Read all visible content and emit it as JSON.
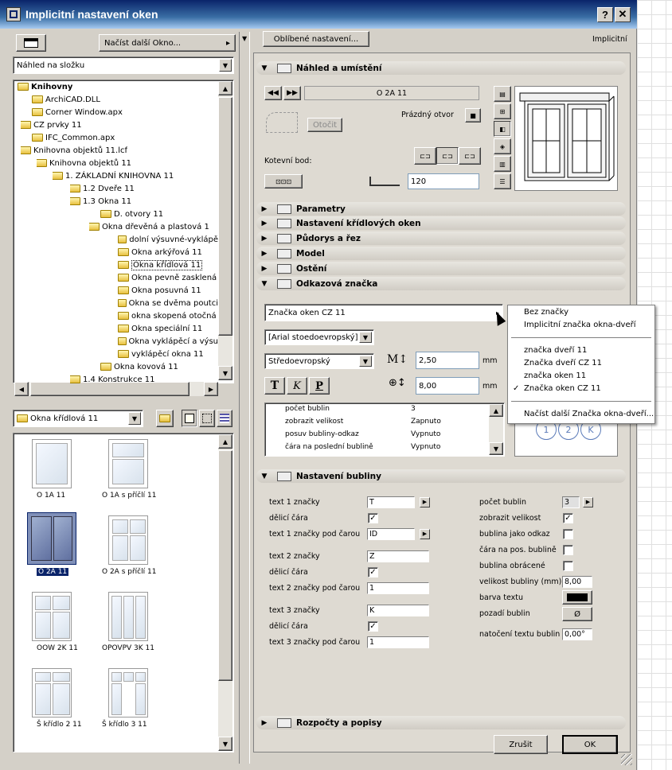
{
  "window": {
    "title": "Implicitní nastavení oken",
    "help": "?",
    "close": "✕"
  },
  "left": {
    "load_button": "Načíst další Okno...",
    "view_select": "Náhled na složku",
    "tree": [
      {
        "label": "Knihovny",
        "bold": true
      },
      {
        "label": "ArchiCAD.DLL"
      },
      {
        "label": "Corner Window.apx"
      },
      {
        "label": "CZ prvky 11"
      },
      {
        "label": "IFC_Common.apx"
      },
      {
        "label": "Knihovna objektů 11.lcf"
      },
      {
        "label": "Knihovna objektů 11"
      },
      {
        "label": "1. ZÁKLADNÍ KNIHOVNA 11"
      },
      {
        "label": "1.2 Dveře 11"
      },
      {
        "label": "1.3 Okna 11"
      },
      {
        "label": "D. otvory 11"
      },
      {
        "label": "Okna dřevěná a plastová 1"
      },
      {
        "label": "dolní výsuvné-vyklápě"
      },
      {
        "label": "Okna arkýřová 11"
      },
      {
        "label": "Okna křídlová 11"
      },
      {
        "label": "Okna pevně zasklená"
      },
      {
        "label": "Okna posuvná 11"
      },
      {
        "label": "Okna se dvěma poutci"
      },
      {
        "label": "okna skopená otočná"
      },
      {
        "label": "Okna speciální 11"
      },
      {
        "label": "Okna vyklápěcí a výsu"
      },
      {
        "label": "vyklápěcí okna 11"
      },
      {
        "label": "Okna kovová 11"
      },
      {
        "label": "1.4 Konstrukce 11"
      }
    ],
    "folder_select": "Okna křídlová 11",
    "thumbs": [
      {
        "label": "O 1A 11"
      },
      {
        "label": "O 1A s příčlí 11"
      },
      {
        "label": "O 2A 11"
      },
      {
        "label": "O 2A s příčlí 11"
      },
      {
        "label": "OOW 2K 11"
      },
      {
        "label": "OPOVPV 3K 11"
      },
      {
        "label": "Š křídlo 2 11"
      },
      {
        "label": "Š křídlo 3 11"
      }
    ]
  },
  "right": {
    "favorites_button": "Oblíbené nastavení...",
    "implicit_label": "Implicitní",
    "preview_section": "Náhled a umístění",
    "object_name": "O 2A 11",
    "empty_opening": "Prázdný otvor",
    "rotate_button": "Otočit",
    "anchor_label": "Kotevní bod:",
    "anchor_value": "120",
    "sections": [
      {
        "label": "Parametry"
      },
      {
        "label": "Nastavení křídlových oken"
      },
      {
        "label": "Půdorys a řez"
      },
      {
        "label": "Model"
      },
      {
        "label": "Ostění"
      },
      {
        "label": "Odkazová značka"
      }
    ],
    "marker_select": "Značka oken CZ 11",
    "font_select": "[Arial stoedoevropský]",
    "encoding_select": "Středoevropský",
    "size1": "2,50",
    "size2": "8,00",
    "unit": "mm",
    "style_buttons": [
      "T",
      "K",
      "P"
    ],
    "param_rows": [
      {
        "name": "počet bublin",
        "value": "3"
      },
      {
        "name": "zobrazit velikost",
        "value": "Zapnuto"
      },
      {
        "name": "posuv bubliny-odkaz",
        "value": "Vypnuto"
      },
      {
        "name": "čára na poslední bublině",
        "value": "Vypnuto"
      }
    ],
    "bubble_letters": [
      "1",
      "2",
      "K"
    ],
    "bubble_section": "Nastavení bubliny",
    "bubble_left": [
      {
        "label": "text 1 značky",
        "value": "T",
        "kind": "input-arrow"
      },
      {
        "label": "dělicí čára",
        "kind": "check"
      },
      {
        "label": "text 1 značky pod čarou",
        "value": "ID",
        "kind": "input-arrow"
      },
      {
        "label": "text 2 značky",
        "value": "Z",
        "kind": "input"
      },
      {
        "label": "dělicí čára",
        "kind": "check"
      },
      {
        "label": "text 2 značky pod čarou",
        "value": "1",
        "kind": "input"
      },
      {
        "label": "text 3 značky",
        "value": "K",
        "kind": "input"
      },
      {
        "label": "dělicí čára",
        "kind": "check"
      },
      {
        "label": "text 3 značky pod čarou",
        "value": "1",
        "kind": "input"
      }
    ],
    "bubble_right": [
      {
        "label": "počet bublin",
        "value": "3"
      },
      {
        "label": "zobrazit velikost",
        "checked": true
      },
      {
        "label": "bublina jako odkaz",
        "checked": false
      },
      {
        "label": "čára na pos. bublině",
        "checked": false
      },
      {
        "label": "bublina obrácené",
        "checked": false
      },
      {
        "label": "velikost bubliny (mm)",
        "value": "8,00"
      },
      {
        "label": "barva textu"
      },
      {
        "label": "pozadí bublin",
        "value": "Ø"
      },
      {
        "label": "natočení textu bublin",
        "value": "0,00°"
      }
    ],
    "budget_section": "Rozpočty a popisy",
    "cancel": "Zrušit",
    "ok": "OK"
  },
  "menu": {
    "items": [
      "Bez značky",
      "Implicitní značka okna-dveří"
    ],
    "items2": [
      "značka dveří 11",
      "Značka dveří CZ 11",
      "značka oken 11",
      "Značka oken CZ 11"
    ],
    "checked_index": 3,
    "load": "Načíst další Značka okna-dveří..."
  },
  "colors": {
    "title_from": "#0a246a",
    "title_to": "#a6caf0",
    "selection": "#0a246a",
    "face": "#d4d0c8"
  }
}
